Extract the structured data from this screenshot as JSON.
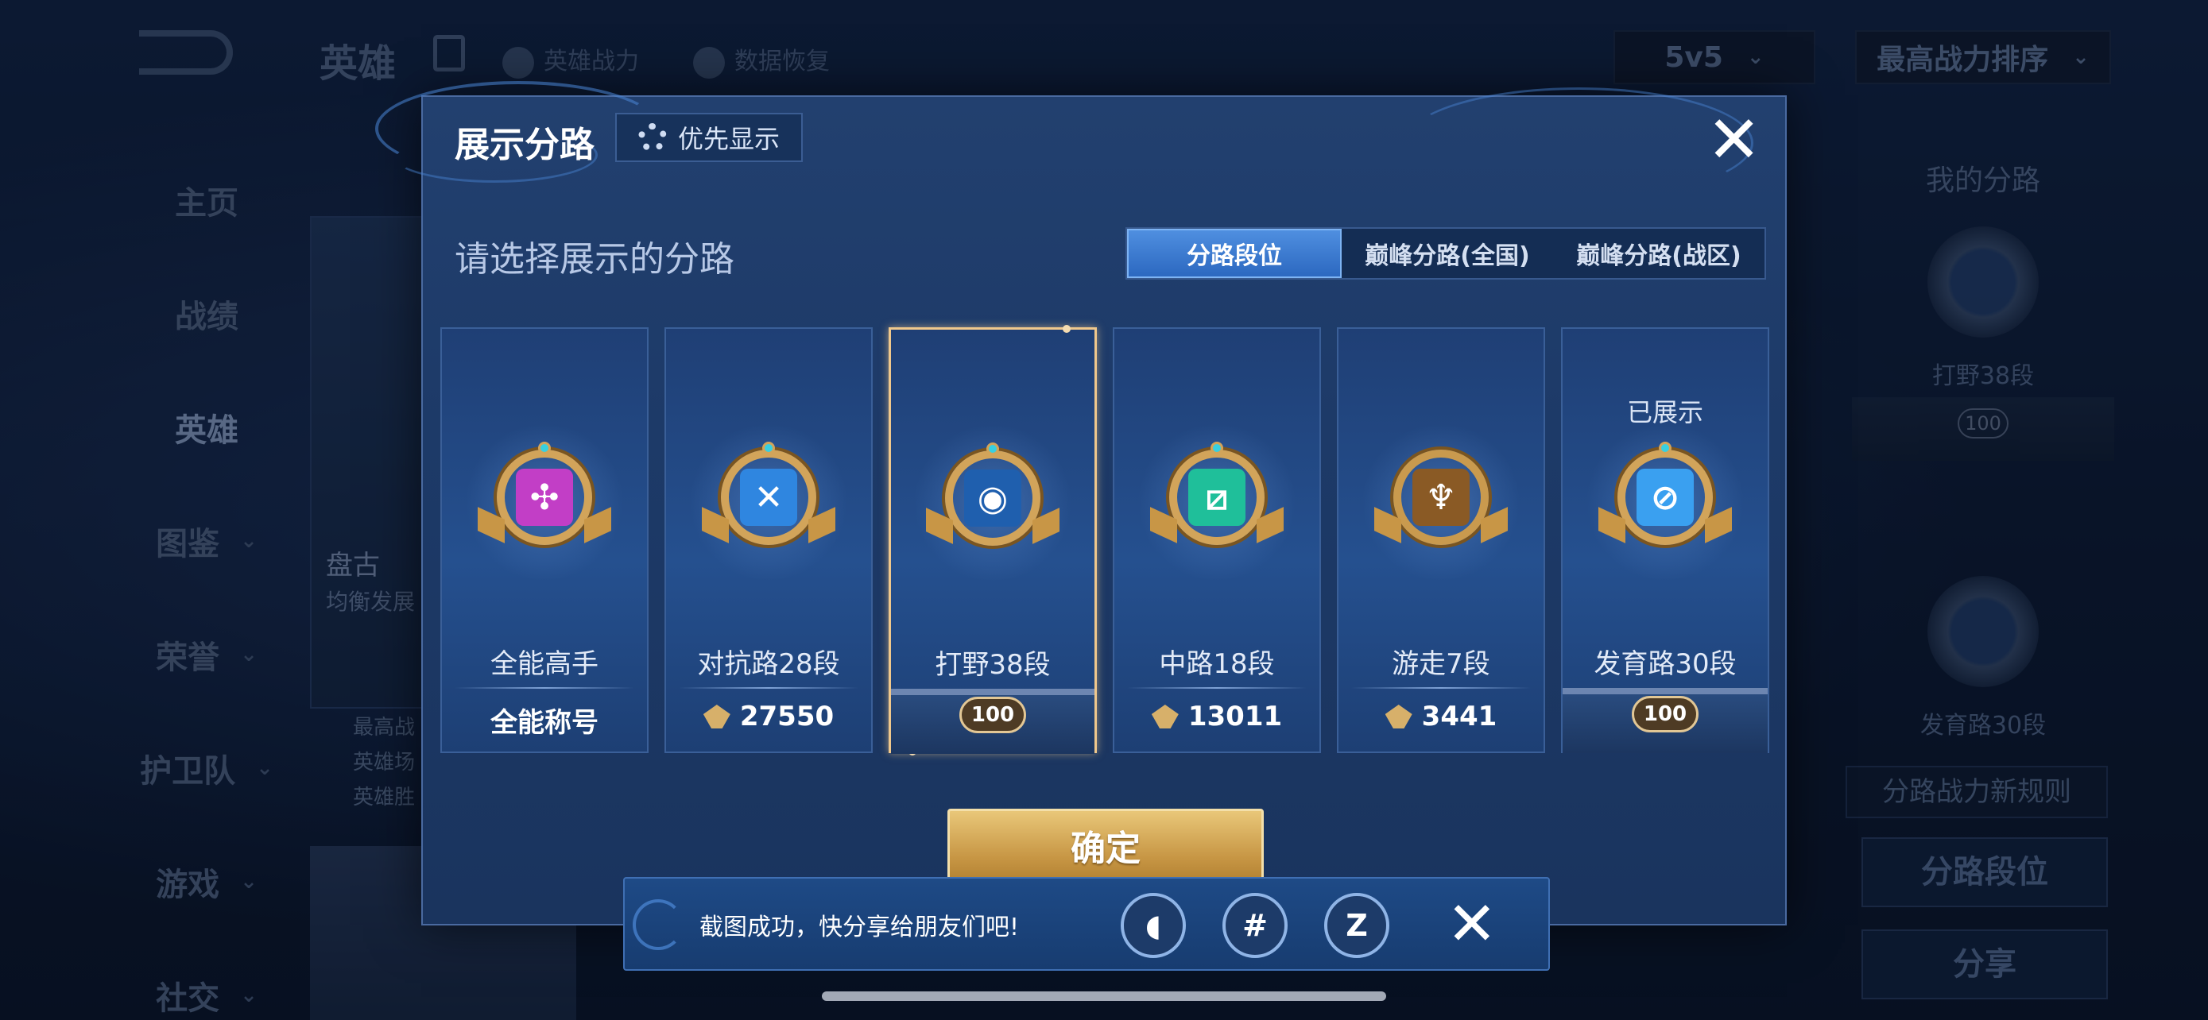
{
  "background": {
    "title": "英雄",
    "links": [
      "英雄战力",
      "数据恢复"
    ],
    "mode_dropdown": "5v5",
    "sort_dropdown": "最高战力排序",
    "side_menu": [
      "主页",
      "战绩",
      "英雄",
      "图鉴",
      "荣誉",
      "护卫队",
      "游戏",
      "社交"
    ],
    "hero_name": "盘古",
    "hero_sub": "均衡发展",
    "hero_stats": [
      "最高战",
      "英雄场",
      "英雄胜"
    ],
    "right_panel": {
      "title": "我的分路",
      "badge1_label": "打野38段",
      "badge1_level": "100",
      "badge2_label": "发育路30段",
      "rule_btn": "分路战力新规则",
      "btn1": "分路段位",
      "btn2": "分享"
    }
  },
  "modal": {
    "title": "展示分路",
    "priority_button": "优先显示",
    "subtitle": "请选择展示的分路",
    "tabs": [
      "分路段位",
      "巅峰分路(全国)",
      "巅峰分路(战区)"
    ],
    "cards": [
      {
        "label": "全能高手",
        "footer": "全能称号",
        "shown": ""
      },
      {
        "label": "对抗路28段",
        "footer": "27550",
        "shown": ""
      },
      {
        "label": "打野38段",
        "footer": "100",
        "shown": ""
      },
      {
        "label": "中路18段",
        "footer": "13011",
        "shown": ""
      },
      {
        "label": "游走7段",
        "footer": "3441",
        "shown": ""
      },
      {
        "label": "发育路30段",
        "footer": "100",
        "shown": "已展示"
      }
    ],
    "confirm": "确定"
  },
  "toast": {
    "message": "截图成功，快分享给朋友们吧!",
    "share_icons": [
      "qq-icon",
      "wechat-moments-icon",
      "qzone-icon"
    ]
  },
  "colors": {
    "accent_gold": "#d2a45a",
    "tab_active": "#2c68c0",
    "modal_bg": "#1d3a68"
  }
}
